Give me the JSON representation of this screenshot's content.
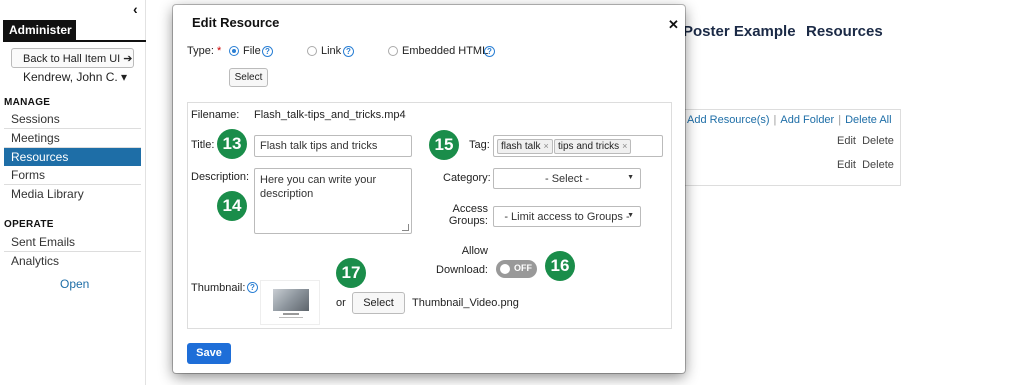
{
  "sidebar": {
    "tab_label": "Administer",
    "collapse_icon": "chevron-left-icon",
    "back_button": "Back to Hall Item UI ➔",
    "user": "Kendrew, John C. ▾",
    "manage_label": "MANAGE",
    "manage_items": [
      {
        "label": "Sessions"
      },
      {
        "label": "Meetings"
      },
      {
        "label": "Resources",
        "active": true
      },
      {
        "label": "Forms"
      },
      {
        "label": "Media Library"
      }
    ],
    "operate_label": "OPERATE",
    "operate_items": [
      {
        "label": "Sent Emails"
      },
      {
        "label": "Analytics"
      }
    ],
    "open_link": "Open"
  },
  "background": {
    "page_title": "Poster Example",
    "section_title": "Resources",
    "actions": [
      "Add Resource(s)",
      "Add Folder",
      "Delete All"
    ],
    "actions_separator": "|",
    "rows": [
      {
        "edit": "Edit",
        "delete": "Delete"
      },
      {
        "edit": "Edit",
        "delete": "Delete"
      }
    ]
  },
  "modal": {
    "title": "Edit Resource",
    "close_icon": "close-icon",
    "type_label": "Type:",
    "required_mark": "*",
    "type_options": [
      {
        "label": "File",
        "checked": true
      },
      {
        "label": "Link",
        "checked": false
      },
      {
        "label": "Embedded HTML",
        "checked": false
      }
    ],
    "help_glyph": "?",
    "select_top_label": "Select",
    "filename_label": "Filename:",
    "filename_value": "Flash_talk-tips_and_tricks.mp4",
    "title_label": "Title:",
    "title_value": "Flash talk tips and tricks",
    "description_label": "Description:",
    "description_value": "Here you can write your description",
    "tag_label": "Tag:",
    "tags": [
      "flash talk",
      "tips and tricks"
    ],
    "tag_remove_glyph": "×",
    "category_label": "Category:",
    "category_value": "- Select -",
    "access_label_1": "Access",
    "access_label_2": "Groups:",
    "access_value": "- Limit access to Groups -",
    "allow_label_1": "Allow",
    "allow_label_2": "Download:",
    "toggle_text": "OFF",
    "thumbnail_label": "Thumbnail:",
    "or_text": "or",
    "select_label": "Select",
    "thumbnail_filename": "Thumbnail_Video.png",
    "save_label": "Save"
  },
  "callouts": [
    "13",
    "14",
    "15",
    "16",
    "17"
  ],
  "colors": {
    "accent": "#1e6ea7",
    "callout": "#1a8d4a",
    "save": "#1e6ed8",
    "title": "#1b2a46"
  }
}
